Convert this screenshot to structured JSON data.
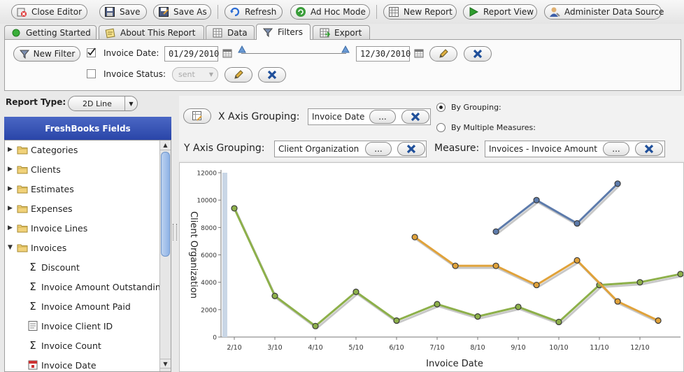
{
  "toolbar": {
    "close_editor": "Close Editor",
    "save": "Save",
    "save_as": "Save As",
    "refresh": "Refresh",
    "ad_hoc_mode": "Ad Hoc Mode",
    "new_report": "New Report",
    "report_view": "Report View",
    "administer": "Administer Data Source"
  },
  "tabs": [
    {
      "label": "Getting Started",
      "icon": "green-dot-icon"
    },
    {
      "label": "About This Report",
      "icon": "notepad-icon"
    },
    {
      "label": "Data",
      "icon": "grid-icon"
    },
    {
      "label": "Filters",
      "icon": "funnel-icon",
      "active": true
    },
    {
      "label": "Export",
      "icon": "export-grid-icon"
    }
  ],
  "filters": {
    "new_filter": "New Filter",
    "invoice_date_label": "Invoice Date:",
    "invoice_date_checked": true,
    "date_from": "01/29/2010",
    "date_to": "12/30/2010",
    "invoice_status_label": "Invoice Status:",
    "invoice_status_checked": false,
    "invoice_status_value": "sent"
  },
  "report_type": {
    "label": "Report Type:",
    "value": "2D Line"
  },
  "fields_panel": {
    "title": "FreshBooks Fields",
    "items": [
      {
        "label": "Categories",
        "type": "folder",
        "expanded": false
      },
      {
        "label": "Clients",
        "type": "folder",
        "expanded": false
      },
      {
        "label": "Estimates",
        "type": "folder",
        "expanded": false
      },
      {
        "label": "Expenses",
        "type": "folder",
        "expanded": false
      },
      {
        "label": "Invoice Lines",
        "type": "folder",
        "expanded": false
      },
      {
        "label": "Invoices",
        "type": "folder",
        "expanded": true
      },
      {
        "label": "Discount",
        "type": "sum"
      },
      {
        "label": "Invoice Amount Outstanding",
        "type": "sum"
      },
      {
        "label": "Invoice Amount Paid",
        "type": "sum"
      },
      {
        "label": "Invoice Client ID",
        "type": "text"
      },
      {
        "label": "Invoice Count",
        "type": "sum"
      },
      {
        "label": "Invoice Date",
        "type": "date"
      }
    ]
  },
  "axis": {
    "x_label": "X Axis Grouping:",
    "x_value": "Invoice Date",
    "y_label": "Y Axis Grouping:",
    "y_value": "Client Organization",
    "measure_label": "Measure:",
    "measure_value": "Invoices - Invoice Amount",
    "browse": "...",
    "by_grouping": "By Grouping:",
    "by_multiple": "By Multiple Measures:",
    "selected_mode": "grouping"
  },
  "colors": {
    "accent_blue": "#2a45a8",
    "series_green": "#8db04a",
    "series_orange": "#e0a23a",
    "series_blue": "#5d7bab"
  },
  "chart_data": {
    "type": "line",
    "xlabel": "Invoice Date",
    "ylabel": "Client Organization",
    "categories": [
      "2/10",
      "3/10",
      "4/10",
      "5/10",
      "6/10",
      "7/10",
      "8/10",
      "9/10",
      "10/10",
      "11/10",
      "12/10"
    ],
    "y_ticks": [
      0,
      2000,
      4000,
      6000,
      8000,
      10000,
      12000
    ],
    "ylim": [
      0,
      12000
    ],
    "series": [
      {
        "color": "#8db04a",
        "points": [
          [
            0,
            9400
          ],
          [
            1,
            3000
          ],
          [
            2,
            800
          ],
          [
            3,
            3300
          ],
          [
            4,
            1200
          ],
          [
            5,
            2400
          ],
          [
            6,
            1500
          ],
          [
            7,
            2200
          ],
          [
            8,
            1100
          ],
          [
            9,
            3800
          ],
          [
            10,
            4000
          ],
          [
            11,
            4600
          ]
        ]
      },
      {
        "color": "#e0a23a",
        "points": [
          [
            4.45,
            7300
          ],
          [
            5.45,
            5200
          ],
          [
            6.45,
            5200
          ],
          [
            7.45,
            3800
          ],
          [
            8.45,
            5600
          ],
          [
            9.45,
            2600
          ],
          [
            10.45,
            1200
          ]
        ]
      },
      {
        "color": "#5d7bab",
        "points": [
          [
            6.45,
            7700
          ],
          [
            7.45,
            10000
          ],
          [
            8.45,
            8300
          ],
          [
            9.45,
            11200
          ]
        ]
      }
    ]
  }
}
